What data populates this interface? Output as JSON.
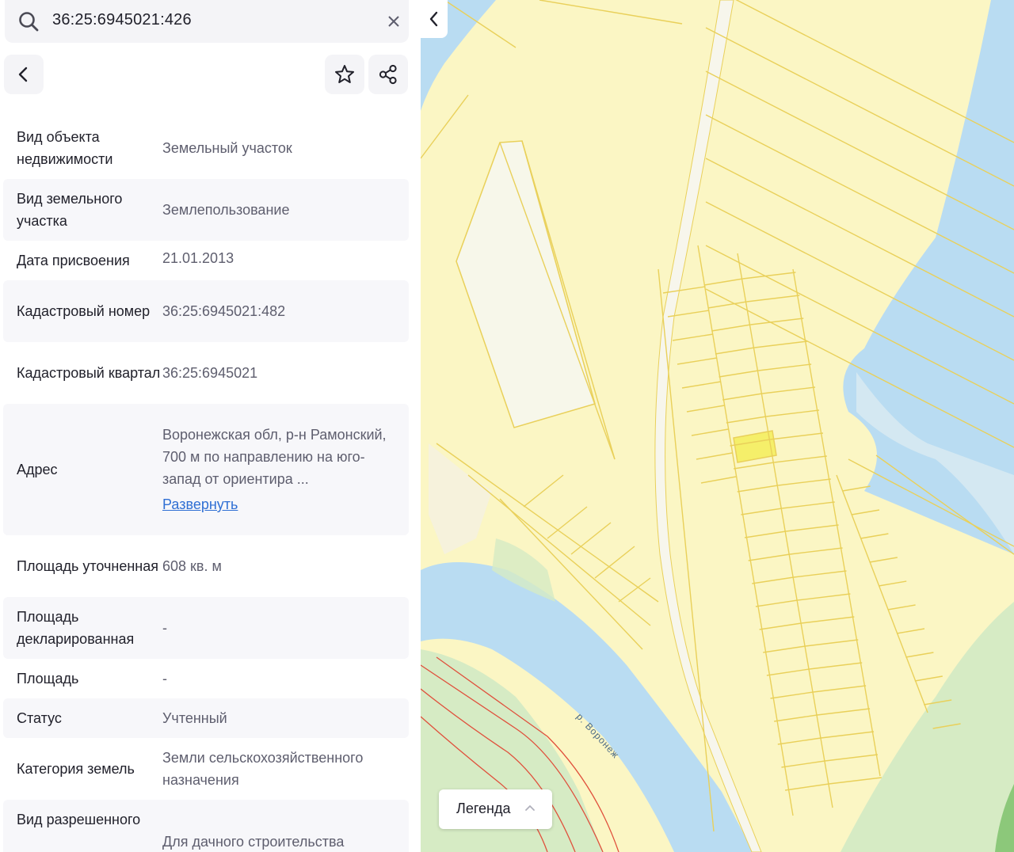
{
  "search": {
    "query": "36:25:6945021:426"
  },
  "actions": {
    "back_icon": "chevron-left-icon",
    "favorite_icon": "star-icon",
    "share_icon": "share-icon"
  },
  "properties": [
    {
      "label": "Вид объекта недвижимости",
      "value": "Земельный участок"
    },
    {
      "label": "Вид земельного участка",
      "value": "Землепользование"
    },
    {
      "label": "Дата присвоения",
      "value": "21.01.2013"
    },
    {
      "label": "Кадастровый номер",
      "value": "36:25:6945021:482"
    },
    {
      "label": "Кадастровый квартал",
      "value": "36:25:6945021"
    },
    {
      "label": "Адрес",
      "value": "Воронежская обл, р-н Рамонский, 700 м по направлению на юго- запад от ориентира ...",
      "link": "Развернуть"
    },
    {
      "label": "Площадь уточненная",
      "value": "608 кв. м"
    },
    {
      "label": "Площадь декларированная",
      "value": "-"
    },
    {
      "label": "Площадь",
      "value": "-"
    },
    {
      "label": "Статус",
      "value": "Учтенный"
    },
    {
      "label": "Категория земель",
      "value": "Земли сельскохозяйственного назначения"
    },
    {
      "label": "Вид разрешенного",
      "value": "Для дачного строительства"
    }
  ],
  "map": {
    "river_label": "р. Воронеж",
    "legend_label": "Легенда",
    "colors": {
      "land": "#fbf6c4",
      "parcel_line": "#e9d05a",
      "water": "#b9dcf2",
      "selected": "#f5ef6a",
      "forest": "#d6ebc4",
      "red_line": "#e0503c"
    }
  }
}
